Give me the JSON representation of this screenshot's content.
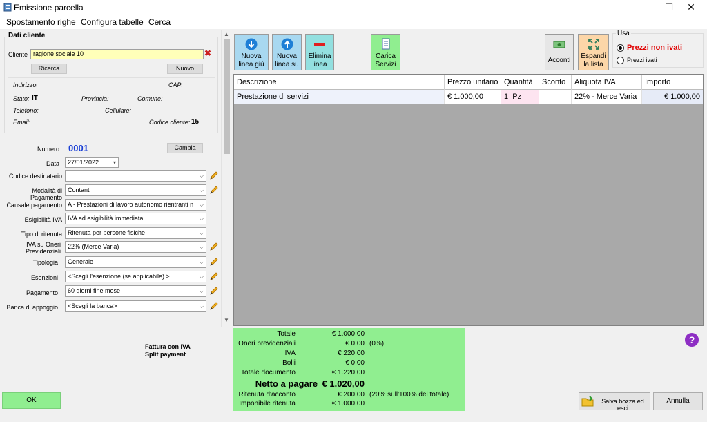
{
  "window": {
    "title": "Emissione parcella"
  },
  "menu": [
    "Spostamento righe",
    "Configura tabelle",
    "Cerca"
  ],
  "cliente": {
    "group_title": "Dati cliente",
    "label": "Cliente",
    "value": "ragione sociale 10",
    "ricerca": "Ricerca",
    "nuovo": "Nuovo",
    "indirizzo": "Indirizzo:",
    "cap": "CAP:",
    "stato": "Stato:",
    "stato_val": "IT",
    "provincia": "Provincia:",
    "comune": "Comune:",
    "telefono": "Telefono:",
    "cellulare": "Cellulare:",
    "email": "Email:",
    "codice": "Codice cliente:",
    "codice_val": "15"
  },
  "form": {
    "numero_label": "Numero",
    "numero": "0001",
    "cambia": "Cambia",
    "data_label": "Data",
    "data": "27/01/2022",
    "codice_destinatario": "Codice destinatario",
    "codice_destinatario_val": "",
    "modalita": "Modalità di Pagamento",
    "modalita_val": "Contanti",
    "causale": "Causale pagamento",
    "causale_val": "A - Prestazioni di lavoro autonomo rientranti n",
    "esigibilita": "Esigibilità IVA",
    "esigibilita_val": "IVA ad esigibilità immediata",
    "ritenuta": "Tipo di ritenuta",
    "ritenuta_val": "Ritenuta per persone fisiche",
    "iva_oneri_1": "IVA su Oneri",
    "iva_oneri_2": "Previdenziali",
    "iva_oneri_val": "22% (Merce Varia)",
    "tipologia": "Tipologia",
    "tipologia_val": "Generale",
    "esenzioni": "Esenzioni",
    "esenzioni_val": "<Scegli l'esenzione (se applicabile) >",
    "pagamento": "Pagamento",
    "pagamento_val": "60 giorni fine mese",
    "banca": "Banca di appoggio",
    "banca_val": "<Scegli la banca>"
  },
  "toolbar": {
    "nuova_giu_1": "Nuova",
    "nuova_giu_2": "linea giù",
    "nuova_su_1": "Nuova",
    "nuova_su_2": "linea su",
    "elimina_1": "Elimina",
    "elimina_2": "linea",
    "carica_1": "Carica",
    "carica_2": "Servizi",
    "acconti": "Acconti",
    "espandi_1": "Espandi",
    "espandi_2": "la lista"
  },
  "usa": {
    "title": "Usa",
    "opt1": "Prezzi non ivati",
    "opt2": "Prezzi ivati",
    "selected": "Prezzi non ivati"
  },
  "grid": {
    "headers": [
      "Descrizione",
      "Prezzo unitario",
      "Quantità",
      "Sconto",
      "Aliquota IVA",
      "Importo"
    ],
    "rows": [
      {
        "descrizione": "Prestazione di servizi",
        "prezzo": "€ 1.000,00",
        "quantita": "1",
        "unita": "Pz",
        "sconto": "",
        "aliquota": "22% - Merce Varia",
        "importo": "€ 1.000,00"
      }
    ]
  },
  "info": {
    "line1": "Fattura con IVA",
    "line2": "Split payment"
  },
  "totals": {
    "totale_l": "Totale",
    "totale_v": "€ 1.000,00",
    "oneri_l": "Oneri previdenziali",
    "oneri_v": "€ 0,00",
    "oneri_n": "(0%)",
    "iva_l": "IVA",
    "iva_v": "€ 220,00",
    "bolli_l": "Bolli",
    "bolli_v": "€ 0,00",
    "totdoc_l": "Totale documento",
    "totdoc_v": "€ 1.220,00",
    "netto_l": "Netto a pagare",
    "netto_v": "€ 1.020,00",
    "ritenuta_l": "Ritenuta d'acconto",
    "ritenuta_v": "€ 200,00",
    "ritenuta_n": "(20% sull'100% del totale)",
    "impon_l": "Imponibile ritenuta",
    "impon_v": "€ 1.000,00"
  },
  "buttons": {
    "ok": "OK",
    "salva": "Salva bozza ed esci",
    "annulla": "Annulla"
  },
  "colors": {
    "green": "#90ee90",
    "yellow": "#ffffb9",
    "blue_number": "#1a3fd6",
    "red": "#e00000"
  }
}
